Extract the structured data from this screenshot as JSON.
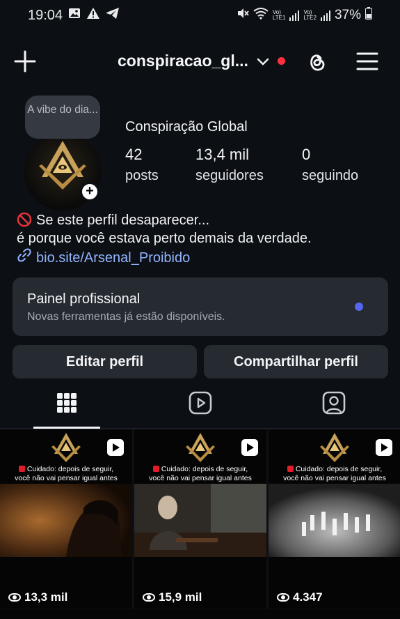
{
  "status_bar": {
    "time": "19:04",
    "battery": "37%",
    "sim1": "LTE1",
    "sim2": "LTE2",
    "volte": "Vo)",
    "icons": [
      "image-icon",
      "warning-icon",
      "telegram-icon",
      "mute-icon",
      "wifi-icon",
      "signal-icon",
      "battery-icon"
    ]
  },
  "header": {
    "username": "conspiracao_gl...",
    "icons": [
      "plus-icon",
      "chevron-down-icon",
      "threads-icon",
      "hamburger-menu-icon"
    ],
    "notification_color": "#ff3040"
  },
  "profile": {
    "note_bubble": "A vibe do dia...",
    "display_name": "Conspiração Global",
    "stats": [
      {
        "value": "42",
        "label": "posts"
      },
      {
        "value": "13,4 mil",
        "label": "seguidores"
      },
      {
        "value": "0",
        "label": "seguindo"
      }
    ],
    "bio_line1": "Se este perfil desaparecer...",
    "bio_line2": "é porque você estava perto demais da verdade.",
    "bio_link": "bio.site/Arsenal_Proibido"
  },
  "professional_panel": {
    "title": "Painel profissional",
    "subtitle": "Novas ferramentas já estão disponíveis.",
    "dot_color": "#5865f2"
  },
  "actions": {
    "edit": "Editar perfil",
    "share": "Compartilhar perfil"
  },
  "tabs": [
    "grid-icon",
    "reels-icon",
    "tagged-icon"
  ],
  "posts": [
    {
      "caption_line1": "Cuidado: depois de seguir,",
      "caption_line2": "você não vai pensar igual antes",
      "views": "13,3 mil"
    },
    {
      "caption_line1": "Cuidado: depois de seguir,",
      "caption_line2": "você não vai pensar igual antes",
      "views": "15,9 mil"
    },
    {
      "caption_line1": "Cuidado: depois de seguir,",
      "caption_line2": "você não vai pensar igual antes",
      "views": "4.347"
    }
  ],
  "colors": {
    "background": "#0c0f14",
    "card": "#262a31",
    "link": "#93b4ff"
  }
}
